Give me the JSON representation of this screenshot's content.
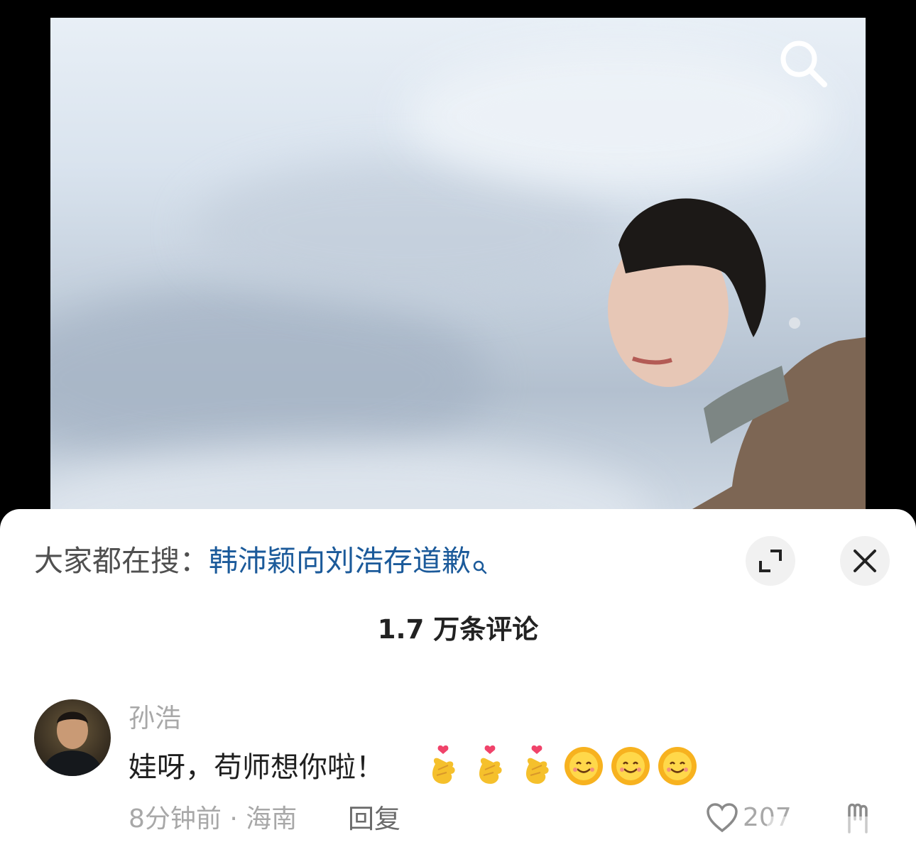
{
  "hot_search": {
    "prefix": "大家都在搜：",
    "term": "韩沛颖向刘浩存道歉"
  },
  "comments_header": {
    "count_label": "1.7 万条评论"
  },
  "comment": {
    "username": "孙浩",
    "text": "娃呀，苟师想你啦！",
    "emojis": [
      "finger-heart-emoji",
      "finger-heart-emoji",
      "finger-heart-emoji",
      "smiling-sun-emoji",
      "smiling-sun-emoji",
      "smiling-sun-emoji"
    ],
    "time": "8分钟前",
    "location": "海南",
    "meta_separator": "·",
    "reply_label": "回复",
    "like_count": "207"
  },
  "colors": {
    "link": "#1b5a9a",
    "muted": "#a8a8a8",
    "sheet_bg": "#ffffff"
  },
  "icons": [
    "search-icon",
    "expand-icon",
    "close-icon",
    "heart-icon",
    "dislike-icon"
  ]
}
